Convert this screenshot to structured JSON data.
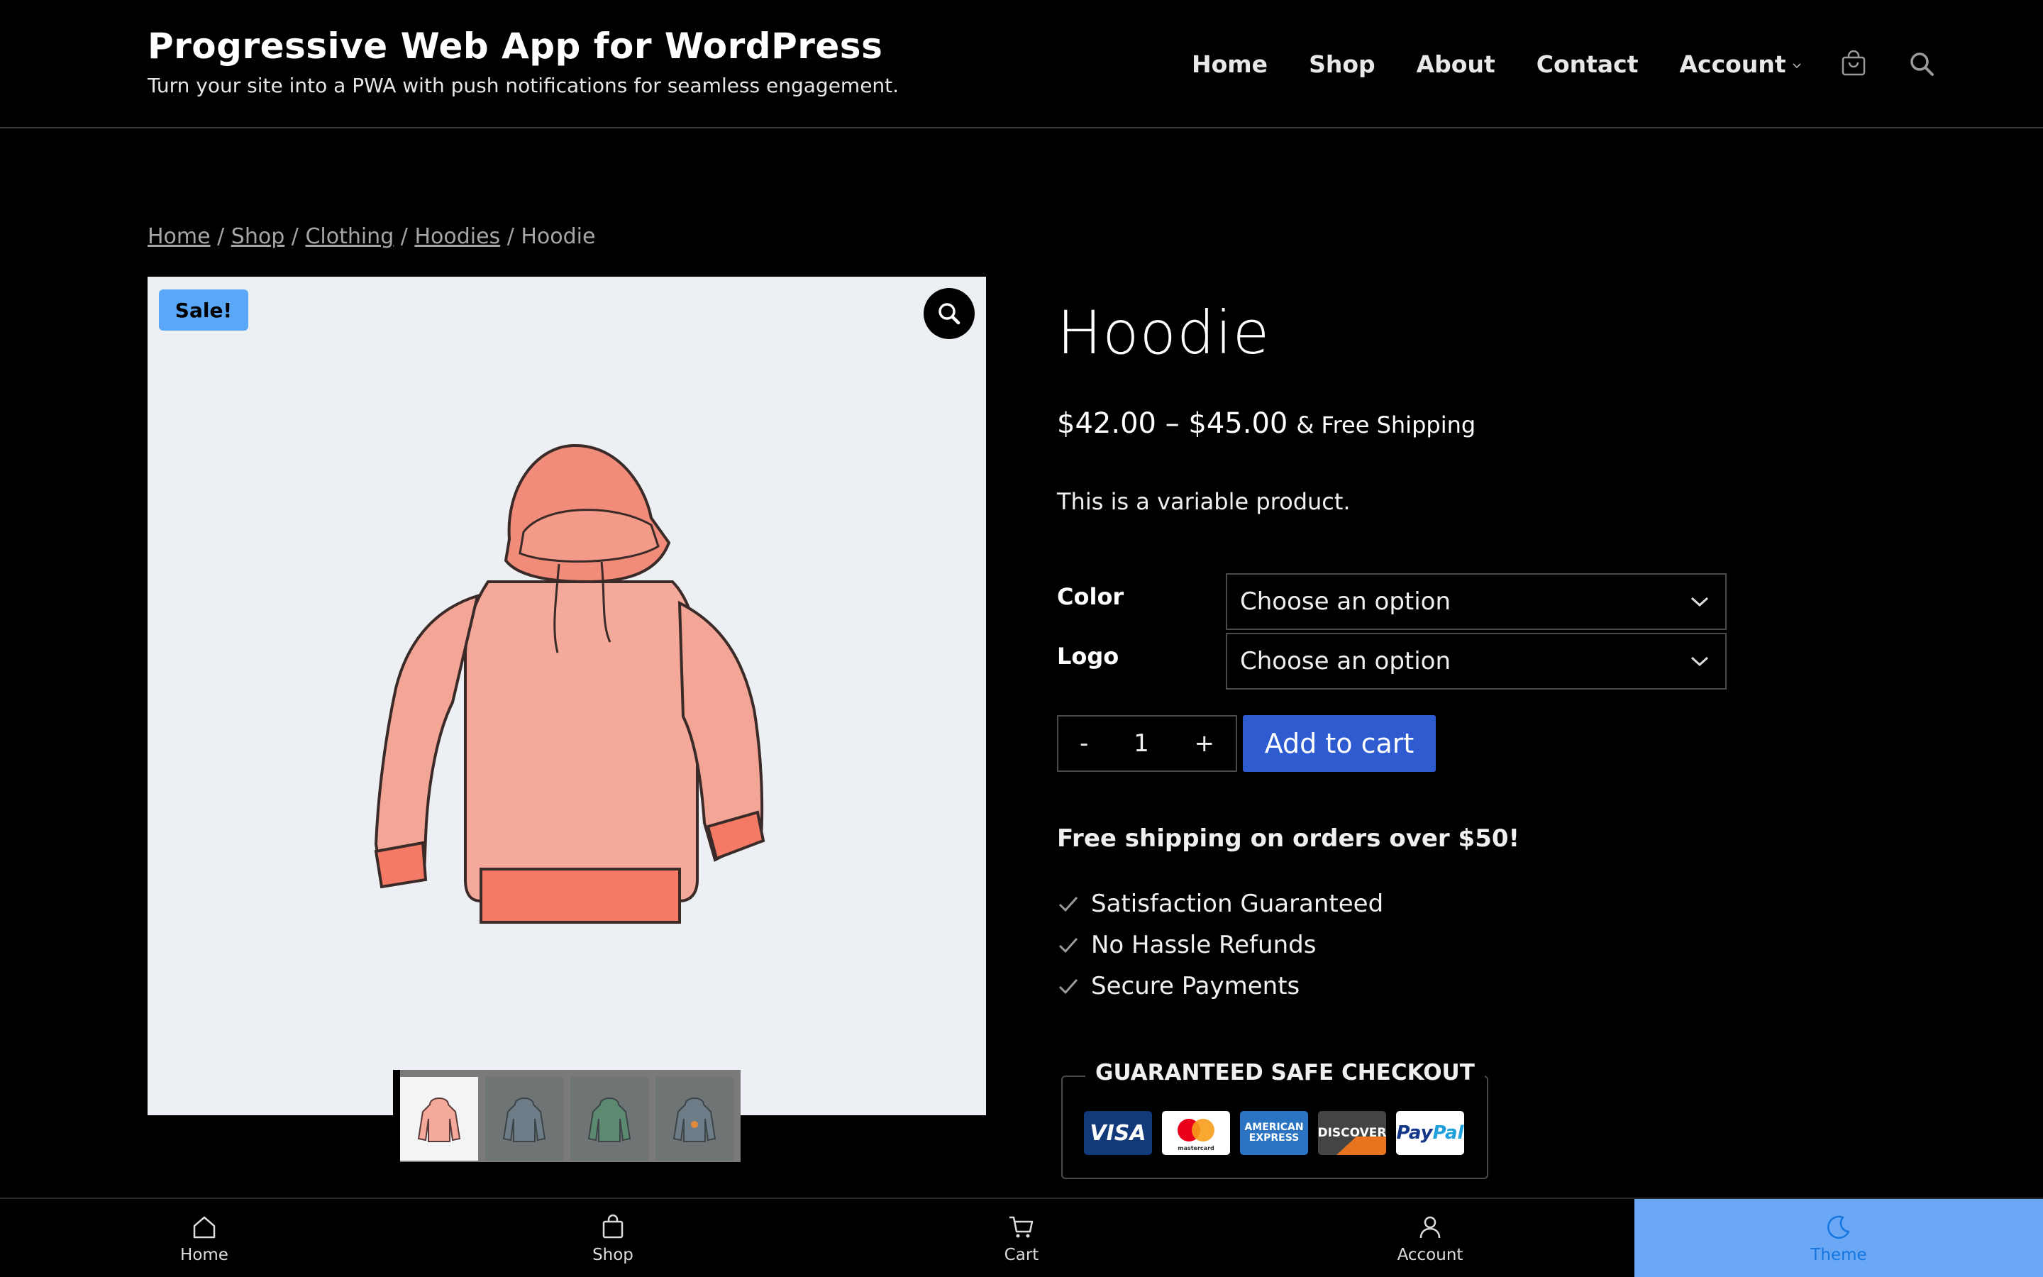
{
  "site": {
    "title": "Progressive Web App for WordPress",
    "tagline": "Turn your site into a PWA with push notifications for seamless engagement."
  },
  "nav": {
    "items": [
      "Home",
      "Shop",
      "About",
      "Contact",
      "Account"
    ],
    "icons": [
      "cart-icon",
      "search-icon"
    ]
  },
  "breadcrumb": {
    "links": [
      "Home",
      "Shop",
      "Clothing",
      "Hoodies"
    ],
    "sep": " / ",
    "current": "Hoodie"
  },
  "gallery": {
    "badge": "Sale!",
    "thumb_count": 4
  },
  "product": {
    "title": "Hoodie",
    "price_low": "$42.00",
    "price_sep": " – ",
    "price_high": "$45.00",
    "shipping": "& Free Shipping",
    "description": "This is a variable product.",
    "variations": [
      {
        "label": "Color",
        "value": "Choose an option"
      },
      {
        "label": "Logo",
        "value": "Choose an option"
      }
    ],
    "qty": {
      "minus": "-",
      "value": "1",
      "plus": "+"
    },
    "add_to_cart": "Add to cart",
    "free_shipping_note": "Free shipping on orders over $50!",
    "trust": [
      "Satisfaction Guaranteed",
      "No Hassle Refunds",
      "Secure Payments"
    ]
  },
  "checkout": {
    "title": "GUARANTEED SAFE CHECKOUT",
    "cards": {
      "visa": "VISA",
      "mastercard": "mastercard",
      "amex_1": "AMERICAN",
      "amex_2": "EXPRESS",
      "discover": "DISCOVER",
      "paypal_1": "Pay",
      "paypal_2": "Pal"
    }
  },
  "bottom_bar": {
    "tabs": [
      "Home",
      "Shop",
      "Cart",
      "Account",
      "Theme"
    ],
    "active": "Theme"
  },
  "colors": {
    "accent_blue": "#2f5bd0",
    "badge_blue": "#5aa7f7",
    "theme_tab_bg": "#6aa8f5",
    "hoodie": "#f4a99a"
  }
}
